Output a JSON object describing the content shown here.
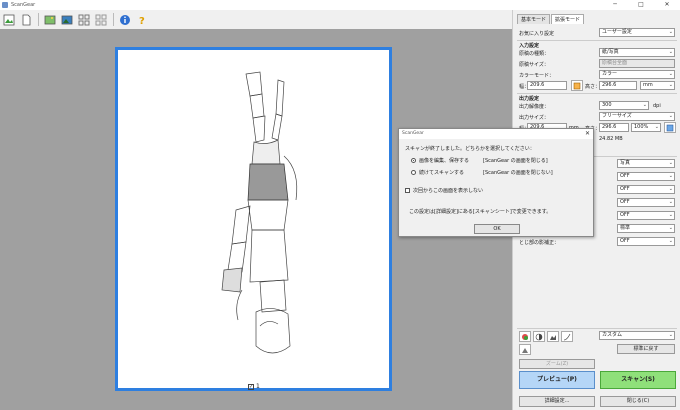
{
  "window": {
    "title": "ScanGear",
    "controls": [
      "─",
      "□",
      "✕"
    ]
  },
  "toolbar": {
    "icons": [
      "image-icon",
      "document-icon",
      "photo-color-icon",
      "photo-bw-icon",
      "thumbnail-grid-icon",
      "crop-grid-icon",
      "info-icon",
      "help-icon"
    ]
  },
  "preview": {
    "checkbox_label": "1"
  },
  "panel": {
    "tabs": [
      "基本モード",
      "拡張モード"
    ],
    "favorites": {
      "label": "お気に入り設定",
      "value": "ユーザー設定"
    },
    "input": {
      "section": "入力設定",
      "doc_type_label": "原稿の種類：",
      "doc_type_value": "紙/写真",
      "doc_size_label": "原稿サイズ：",
      "doc_size_value": "原稿台全面",
      "color_mode_label": "カラーモード：",
      "color_mode_value": "カラー",
      "width_label": "幅：",
      "width_value": "209.6",
      "height_label": "高さ：",
      "height_value": "296.6",
      "unit": "mm"
    },
    "output": {
      "section": "出力設定",
      "resolution_label": "出力解像度：",
      "resolution_value": "300",
      "resolution_unit": "dpi",
      "size_label": "出力サイズ：",
      "size_value": "フリーサイズ",
      "width_label": "幅：",
      "width_value": "209.6",
      "unit": "mm",
      "height_label": "高さ：",
      "height_value": "296.6",
      "scale_value": "100%",
      "data_size": "24.82 MB"
    },
    "adjust": {
      "rows": [
        {
          "label": "",
          "value": "写真"
        },
        {
          "label": "",
          "value": "OFF"
        },
        {
          "label": "",
          "value": "OFF"
        },
        {
          "label": "",
          "value": "OFF"
        },
        {
          "label": "",
          "value": "OFF"
        },
        {
          "label": "",
          "value": "標準"
        },
        {
          "label": "とじ部の影補正：",
          "value": "OFF"
        }
      ]
    },
    "color_preset": "カスタム",
    "reset_button": "標準に戻す",
    "zoom_button": "ズーム(Z)",
    "preview_button": "プレビュー(P)",
    "scan_button": "スキャン(S)",
    "prefs_button": "詳細設定...",
    "close_button": "閉じる(C)"
  },
  "dialog": {
    "title": "ScanGear",
    "message": "スキャンが終了しました。どちらかを選択してください：",
    "option1_label": "画像を編集、保存する",
    "option1_desc": "[ScanGear の画面を閉じる]",
    "option2_label": "続けてスキャンする",
    "option2_desc": "[ScanGear の画面を閉じない]",
    "dont_show_label": "次回からこの画面を表示しない",
    "note": "この設定は[詳細設定]にある[スキャンシート]で変更できます。",
    "ok_label": "OK"
  },
  "colors": {
    "accent_blue": "#2e7fe0",
    "preview_btn": "#b5d6f7",
    "scan_btn": "#8fe07a"
  }
}
